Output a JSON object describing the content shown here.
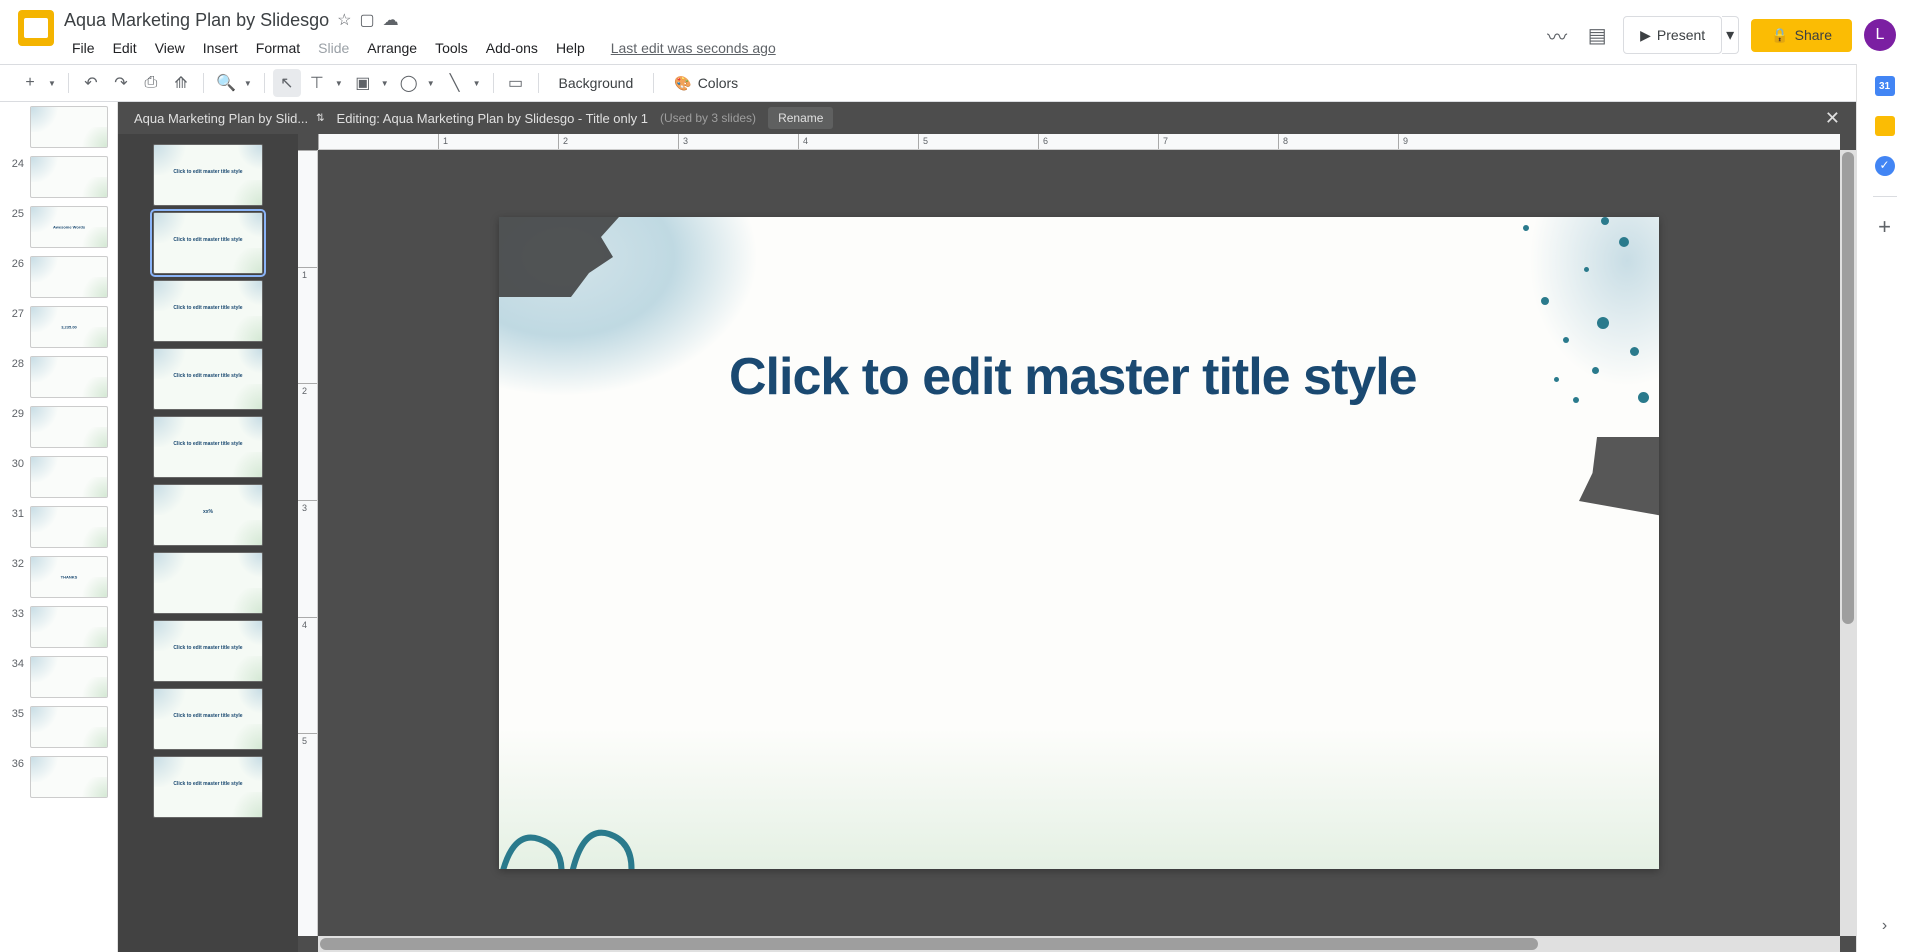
{
  "header": {
    "doc_title": "Aqua Marketing Plan by Slidesgo",
    "menus": [
      "File",
      "Edit",
      "View",
      "Insert",
      "Format",
      "Slide",
      "Arrange",
      "Tools",
      "Add-ons",
      "Help"
    ],
    "last_edit": "Last edit was seconds ago",
    "present": "Present",
    "share": "Share",
    "avatar_letter": "L"
  },
  "toolbar": {
    "background": "Background",
    "colors": "Colors"
  },
  "master": {
    "dropdown": "Aqua Marketing Plan by Slid...",
    "editing_label": "Editing: Aqua Marketing Plan by Slidesgo - Title only 1",
    "used_by": "(Used by 3 slides)",
    "rename": "Rename",
    "title_placeholder": "Click to edit master title style"
  },
  "slides": [
    {
      "num": "",
      "text": ""
    },
    {
      "num": "24",
      "text": ""
    },
    {
      "num": "25",
      "text": "Awesome Words"
    },
    {
      "num": "26",
      "text": ""
    },
    {
      "num": "27",
      "text": "3,235.00"
    },
    {
      "num": "28",
      "text": ""
    },
    {
      "num": "29",
      "text": ""
    },
    {
      "num": "30",
      "text": ""
    },
    {
      "num": "31",
      "text": ""
    },
    {
      "num": "32",
      "text": "THANKS"
    },
    {
      "num": "33",
      "text": ""
    },
    {
      "num": "34",
      "text": ""
    },
    {
      "num": "35",
      "text": ""
    },
    {
      "num": "36",
      "text": ""
    }
  ],
  "layouts": [
    {
      "text": "Click to edit master title style",
      "selected": false
    },
    {
      "text": "Click to edit master title style",
      "selected": true
    },
    {
      "text": "Click to edit master title style",
      "selected": false
    },
    {
      "text": "Click to edit master title style",
      "selected": false
    },
    {
      "text": "Click to edit master title style",
      "selected": false
    },
    {
      "text": "xx%",
      "selected": false
    },
    {
      "text": "",
      "selected": false
    },
    {
      "text": "Click to edit master title style",
      "selected": false
    },
    {
      "text": "Click to edit master title style",
      "selected": false
    },
    {
      "text": "Click to edit master title style",
      "selected": false
    }
  ],
  "right_sidebar": {
    "calendar_day": "31"
  },
  "ruler_h_ticks": [
    "",
    "1",
    "2",
    "3",
    "4",
    "5",
    "6",
    "7",
    "8",
    "9"
  ],
  "ruler_v_ticks": [
    "",
    "1",
    "2",
    "3",
    "4",
    "5"
  ]
}
